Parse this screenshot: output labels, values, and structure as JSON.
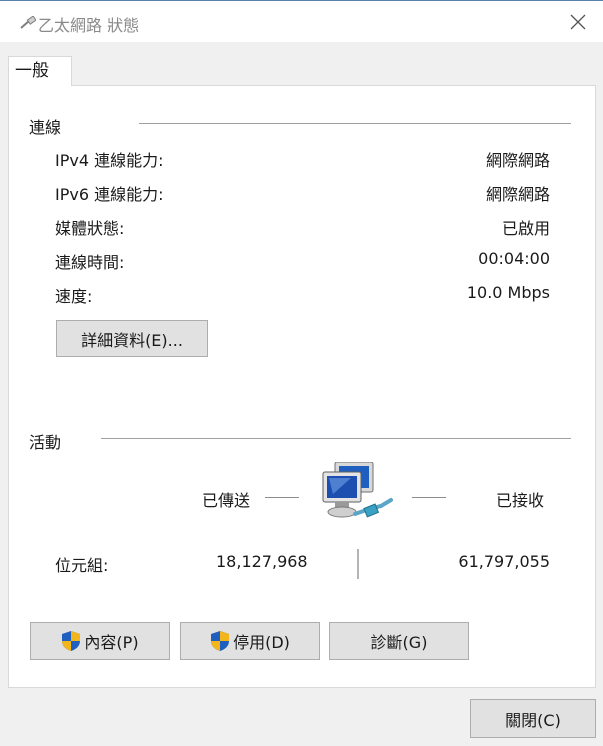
{
  "window": {
    "title": "乙太網路 狀態",
    "close_icon": "close-icon"
  },
  "tabs": [
    {
      "label": "一般",
      "selected": true
    }
  ],
  "connection": {
    "section_title": "連線",
    "rows": [
      {
        "label": "IPv4 連線能力:",
        "value": "網際網路"
      },
      {
        "label": "IPv6 連線能力:",
        "value": "網際網路"
      },
      {
        "label": "媒體狀態:",
        "value": "已啟用"
      },
      {
        "label": "連線時間:",
        "value": "00:04:00"
      },
      {
        "label": "速度:",
        "value": "10.0 Mbps"
      }
    ],
    "details_button": "詳細資料(E)..."
  },
  "activity": {
    "section_title": "活動",
    "sent_label": "已傳送",
    "received_label": "已接收",
    "bytes_label": "位元組:",
    "bytes_sent": "18,127,968",
    "bytes_received": "61,797,055",
    "icon": "network-computers-icon"
  },
  "actions": {
    "properties": "內容(P)",
    "disable": "停用(D)",
    "diagnose": "診斷(G)",
    "close": "關閉(C)"
  },
  "colors": {
    "accent_blue": "#1f5fbf",
    "shield_yellow": "#f2b51c",
    "border": "#adadad"
  }
}
